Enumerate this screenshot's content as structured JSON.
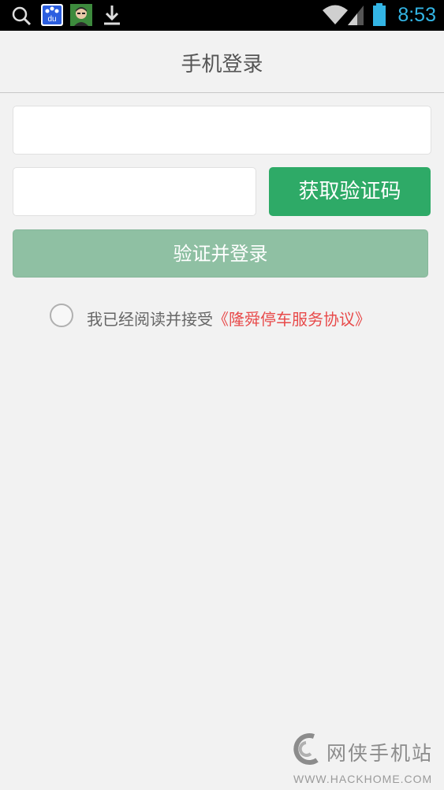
{
  "status_bar": {
    "time": "8:53",
    "icons": [
      "search-icon",
      "baidu-app-icon",
      "avatar-app-icon",
      "download-icon",
      "wifi-icon",
      "signal-icon",
      "battery-icon"
    ],
    "baidu_label": "du",
    "clock_color": "#33b5e5"
  },
  "header": {
    "title": "手机登录"
  },
  "form": {
    "phone_value": "",
    "code_value": "",
    "get_code_label": "获取验证码",
    "login_label": "验证并登录",
    "agreement_prefix": "我已经阅读并接受",
    "agreement_link": "《隆舜停车服务协议》",
    "agreement_checked": false
  },
  "colors": {
    "primary_green": "#2eaa67",
    "disabled_green": "#8fc0a3",
    "link_red": "#e84a4a",
    "background": "#f2f2f2"
  },
  "watermark": {
    "title": "网侠手机站",
    "url": "WWW.HACKHOME.COM"
  }
}
